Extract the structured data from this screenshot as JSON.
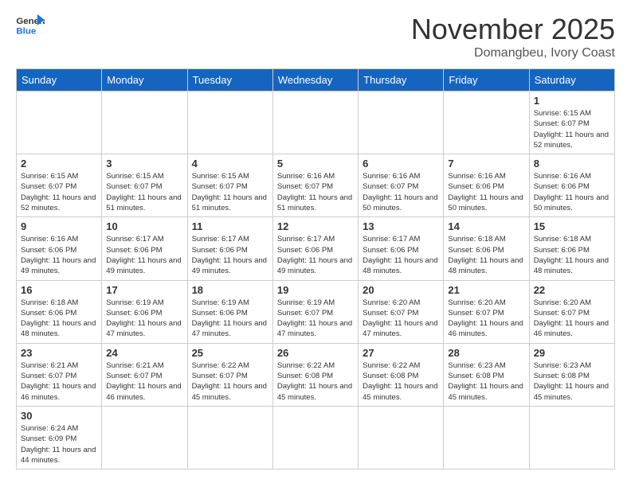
{
  "header": {
    "logo_general": "General",
    "logo_blue": "Blue",
    "month_title": "November 2025",
    "subtitle": "Domangbeu, Ivory Coast"
  },
  "days_of_week": [
    "Sunday",
    "Monday",
    "Tuesday",
    "Wednesday",
    "Thursday",
    "Friday",
    "Saturday"
  ],
  "weeks": [
    [
      {
        "day": "",
        "info": ""
      },
      {
        "day": "",
        "info": ""
      },
      {
        "day": "",
        "info": ""
      },
      {
        "day": "",
        "info": ""
      },
      {
        "day": "",
        "info": ""
      },
      {
        "day": "",
        "info": ""
      },
      {
        "day": "1",
        "info": "Sunrise: 6:15 AM\nSunset: 6:07 PM\nDaylight: 11 hours and 52 minutes."
      }
    ],
    [
      {
        "day": "2",
        "info": "Sunrise: 6:15 AM\nSunset: 6:07 PM\nDaylight: 11 hours and 52 minutes."
      },
      {
        "day": "3",
        "info": "Sunrise: 6:15 AM\nSunset: 6:07 PM\nDaylight: 11 hours and 51 minutes."
      },
      {
        "day": "4",
        "info": "Sunrise: 6:15 AM\nSunset: 6:07 PM\nDaylight: 11 hours and 51 minutes."
      },
      {
        "day": "5",
        "info": "Sunrise: 6:16 AM\nSunset: 6:07 PM\nDaylight: 11 hours and 51 minutes."
      },
      {
        "day": "6",
        "info": "Sunrise: 6:16 AM\nSunset: 6:07 PM\nDaylight: 11 hours and 50 minutes."
      },
      {
        "day": "7",
        "info": "Sunrise: 6:16 AM\nSunset: 6:06 PM\nDaylight: 11 hours and 50 minutes."
      },
      {
        "day": "8",
        "info": "Sunrise: 6:16 AM\nSunset: 6:06 PM\nDaylight: 11 hours and 50 minutes."
      }
    ],
    [
      {
        "day": "9",
        "info": "Sunrise: 6:16 AM\nSunset: 6:06 PM\nDaylight: 11 hours and 49 minutes."
      },
      {
        "day": "10",
        "info": "Sunrise: 6:17 AM\nSunset: 6:06 PM\nDaylight: 11 hours and 49 minutes."
      },
      {
        "day": "11",
        "info": "Sunrise: 6:17 AM\nSunset: 6:06 PM\nDaylight: 11 hours and 49 minutes."
      },
      {
        "day": "12",
        "info": "Sunrise: 6:17 AM\nSunset: 6:06 PM\nDaylight: 11 hours and 49 minutes."
      },
      {
        "day": "13",
        "info": "Sunrise: 6:17 AM\nSunset: 6:06 PM\nDaylight: 11 hours and 48 minutes."
      },
      {
        "day": "14",
        "info": "Sunrise: 6:18 AM\nSunset: 6:06 PM\nDaylight: 11 hours and 48 minutes."
      },
      {
        "day": "15",
        "info": "Sunrise: 6:18 AM\nSunset: 6:06 PM\nDaylight: 11 hours and 48 minutes."
      }
    ],
    [
      {
        "day": "16",
        "info": "Sunrise: 6:18 AM\nSunset: 6:06 PM\nDaylight: 11 hours and 48 minutes."
      },
      {
        "day": "17",
        "info": "Sunrise: 6:19 AM\nSunset: 6:06 PM\nDaylight: 11 hours and 47 minutes."
      },
      {
        "day": "18",
        "info": "Sunrise: 6:19 AM\nSunset: 6:06 PM\nDaylight: 11 hours and 47 minutes."
      },
      {
        "day": "19",
        "info": "Sunrise: 6:19 AM\nSunset: 6:07 PM\nDaylight: 11 hours and 47 minutes."
      },
      {
        "day": "20",
        "info": "Sunrise: 6:20 AM\nSunset: 6:07 PM\nDaylight: 11 hours and 47 minutes."
      },
      {
        "day": "21",
        "info": "Sunrise: 6:20 AM\nSunset: 6:07 PM\nDaylight: 11 hours and 46 minutes."
      },
      {
        "day": "22",
        "info": "Sunrise: 6:20 AM\nSunset: 6:07 PM\nDaylight: 11 hours and 46 minutes."
      }
    ],
    [
      {
        "day": "23",
        "info": "Sunrise: 6:21 AM\nSunset: 6:07 PM\nDaylight: 11 hours and 46 minutes."
      },
      {
        "day": "24",
        "info": "Sunrise: 6:21 AM\nSunset: 6:07 PM\nDaylight: 11 hours and 46 minutes."
      },
      {
        "day": "25",
        "info": "Sunrise: 6:22 AM\nSunset: 6:07 PM\nDaylight: 11 hours and 45 minutes."
      },
      {
        "day": "26",
        "info": "Sunrise: 6:22 AM\nSunset: 6:08 PM\nDaylight: 11 hours and 45 minutes."
      },
      {
        "day": "27",
        "info": "Sunrise: 6:22 AM\nSunset: 6:08 PM\nDaylight: 11 hours and 45 minutes."
      },
      {
        "day": "28",
        "info": "Sunrise: 6:23 AM\nSunset: 6:08 PM\nDaylight: 11 hours and 45 minutes."
      },
      {
        "day": "29",
        "info": "Sunrise: 6:23 AM\nSunset: 6:08 PM\nDaylight: 11 hours and 45 minutes."
      }
    ],
    [
      {
        "day": "30",
        "info": "Sunrise: 6:24 AM\nSunset: 6:09 PM\nDaylight: 11 hours and 44 minutes."
      },
      {
        "day": "",
        "info": ""
      },
      {
        "day": "",
        "info": ""
      },
      {
        "day": "",
        "info": ""
      },
      {
        "day": "",
        "info": ""
      },
      {
        "day": "",
        "info": ""
      },
      {
        "day": "",
        "info": ""
      }
    ]
  ]
}
